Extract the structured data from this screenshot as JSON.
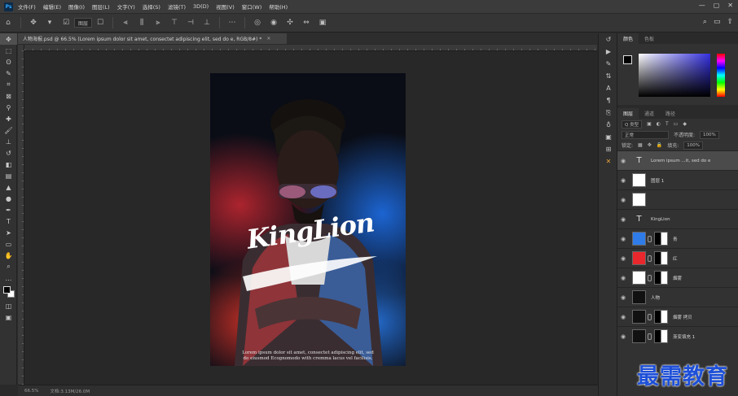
{
  "app": {
    "logo": "Ps",
    "menu": [
      "文件(F)",
      "编辑(E)",
      "图像(I)",
      "图层(L)",
      "文字(Y)",
      "选择(S)",
      "滤镜(T)",
      "3D(D)",
      "视图(V)",
      "窗口(W)",
      "帮助(H)"
    ]
  },
  "options": {
    "home_icon": "home-icon",
    "select_value": "图层",
    "icons": [
      "move-icon",
      "align-icons",
      "distribute-icons",
      "3d-mode-icons"
    ]
  },
  "document": {
    "tab_title": "人物海报.psd @ 66.5% (Lorem ipsum dolor sit amet, consectet adipiscing elit, sed do e, RGB/8#) *",
    "close_glyph": "×"
  },
  "artwork": {
    "brand_text": "KingLion",
    "body_text": "Lorem ipsum dolor sit amet, consectet adipiscing elit, sed do eiusmod Ecognomodo with cremma lacus vel facilisis."
  },
  "status": {
    "zoom": "66.5%",
    "doc_info": "文档:3.13M/26.0M"
  },
  "color_panel": {
    "tabs": [
      "颜色",
      "色板"
    ]
  },
  "layers_panel": {
    "tabs": [
      "图层",
      "通道",
      "路径"
    ],
    "filter_label": "Q 类型",
    "blend_mode": "正常",
    "opacity_label": "不透明度:",
    "opacity_value": "100%",
    "lock_label": "锁定:",
    "fill_label": "填充:",
    "fill_value": "100%",
    "layers": [
      {
        "name": "Lorem ipsum ...it, sed do e",
        "kind": "type"
      },
      {
        "name": "图层 1",
        "kind": "pixel"
      },
      {
        "name": "",
        "kind": "pixel"
      },
      {
        "name": "KingLion",
        "kind": "type"
      },
      {
        "name": "青",
        "kind": "fill-mask",
        "color": "#2f7be8"
      },
      {
        "name": "红",
        "kind": "fill-mask",
        "color": "#e8282c"
      },
      {
        "name": "烟雾",
        "kind": "mask"
      },
      {
        "name": "人物",
        "kind": "pixel"
      },
      {
        "name": "烟雾 拷贝",
        "kind": "mask"
      },
      {
        "name": "渐变填充 1",
        "kind": "fill-mask"
      }
    ]
  },
  "watermark": {
    "text": "最需教育"
  },
  "colors": {
    "accent": "#31a8ff",
    "watermark": "#1d4fd8"
  }
}
